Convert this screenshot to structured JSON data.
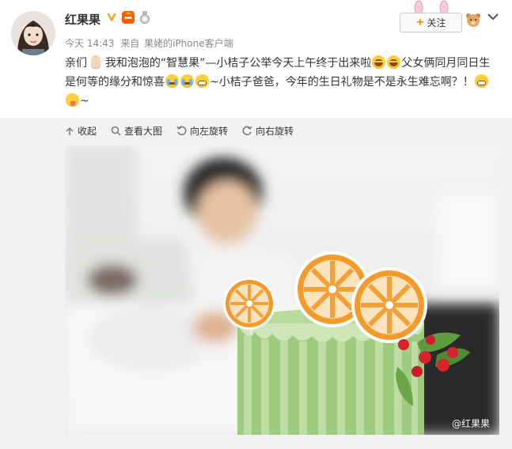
{
  "user": {
    "name": "红果果",
    "avatar_icon": "avatar-photo",
    "badges": {
      "verified_icon": "v-badge-icon",
      "vip_icon": "vip-badge-icon",
      "medal_icon": "medal-icon"
    }
  },
  "post": {
    "time": "今天 14:43",
    "source_prefix": "来自",
    "source": "果姥的iPhone客户端",
    "text": {
      "p1": "亲们",
      "p2": "我和泡泡的“智慧果”—小桔子公举今天上午终于出来啦",
      "p3": "父女俩同月同日生是何等的缘分和惊喜",
      "p4": "~小桔子爸爸，今年的生日礼物是不是永生难忘啊？！",
      "p5": "~"
    }
  },
  "actions": {
    "follow_label": "关注",
    "more_icon": "chevron-down-icon"
  },
  "toolbar": {
    "collapse": "收起",
    "view_large": "查看大图",
    "rotate_left": "向左旋转",
    "rotate_right": "向右旋转"
  },
  "image": {
    "watermark": "@红果果",
    "description_icon": "photo-cake-orange"
  },
  "colors": {
    "accent": "#ff8200",
    "panel_bg": "#f2f2f5",
    "cake_green": "#9cc97a",
    "orange": "#f6a13a"
  }
}
